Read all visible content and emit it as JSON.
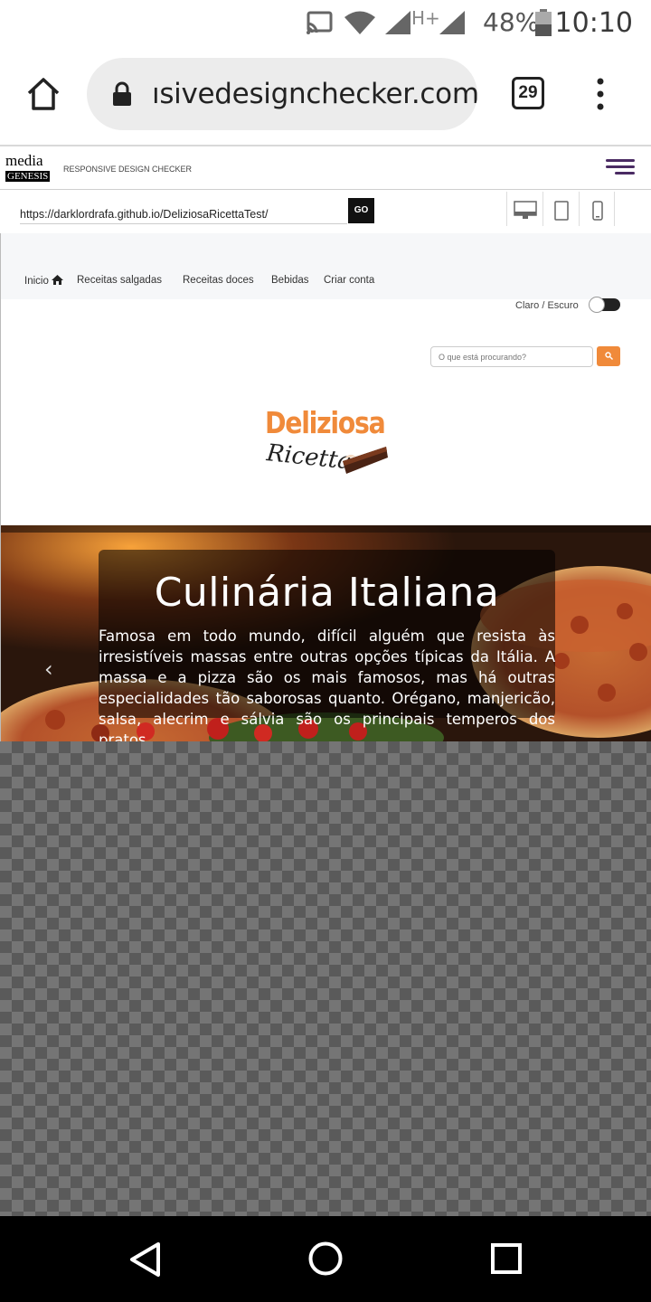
{
  "status_bar": {
    "battery_percent": "48%",
    "time": "10:10",
    "network_type": "H+",
    "icons": [
      "cast-icon",
      "wifi-icon",
      "signal-icon",
      "battery-icon"
    ]
  },
  "browser": {
    "url": "ısivedesigncheck​er.com",
    "tab_count": "29",
    "icons": [
      "home-icon",
      "lock-icon",
      "more-vert-icon"
    ]
  },
  "tool": {
    "logo_line1": "media",
    "logo_line2": "GENESIS",
    "title": "RESPONSIVE DESIGN CHECKER",
    "url_value": "https://darklordrafa.github.io/DeliziosaRicettaTest/",
    "go_label": "GO",
    "devices": [
      "desktop-icon",
      "tablet-icon",
      "phone-icon"
    ]
  },
  "site": {
    "nav": {
      "home": "Inicio",
      "salgadas": "Receitas salgadas",
      "doces": "Receitas doces",
      "bebidas": "Bebidas",
      "criar_conta": "Criar conta"
    },
    "theme_label": "Claro / Escuro",
    "search_placeholder": "O que está procurando?",
    "brand_line1": "Deliziosa",
    "brand_line2": "Ricetta",
    "accent_color": "#f08a3a",
    "hero": {
      "title": "Culinária Italiana",
      "text": "Famosa em todo mundo, difícil alguém que resista às irresistíveis massas entre outras opções típicas da Itália. A massa e a pizza são os mais famosos, mas há outras especialidades tão saborosas quanto. Orégano, manjericão, salsa, alecrim e sálvia são os principais temperos dos pratos.",
      "prev_arrow": "‹"
    }
  }
}
